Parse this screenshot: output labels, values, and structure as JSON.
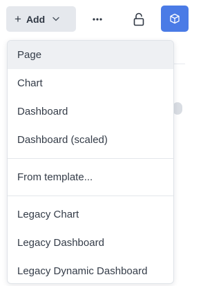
{
  "toolbar": {
    "add_label": "Add",
    "add_prefix": "+",
    "more_label": "···",
    "icons": {
      "add_chevron": "chevron-down-icon",
      "more": "more-horizontal-icon",
      "lock": "unlock-icon",
      "cube": "cube-icon"
    },
    "colors": {
      "add_bg": "#e5e8ed",
      "accent": "#4a7be6"
    }
  },
  "menu": {
    "groups": [
      [
        {
          "label": "Page",
          "selected": true
        },
        {
          "label": "Chart"
        },
        {
          "label": "Dashboard"
        },
        {
          "label": "Dashboard (scaled)"
        }
      ],
      [
        {
          "label": "From template..."
        }
      ],
      [
        {
          "label": "Legacy Chart"
        },
        {
          "label": "Legacy Dashboard"
        },
        {
          "label": "Legacy Dynamic Dashboard"
        }
      ]
    ]
  }
}
